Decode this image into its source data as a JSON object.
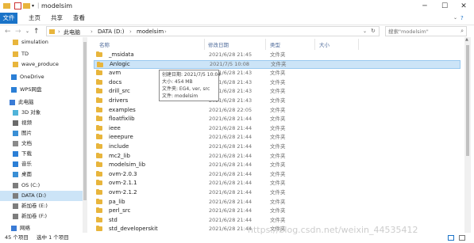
{
  "window": {
    "title": "modelsim"
  },
  "ribbon": {
    "tabs": [
      "文件",
      "主页",
      "共享",
      "查看"
    ]
  },
  "address": {
    "crumbs": [
      "此电脑",
      "DATA (D:)",
      "modelsim"
    ]
  },
  "search": {
    "placeholder": "搜索\"modelsim\""
  },
  "sidebar": {
    "items": [
      {
        "label": "simulation",
        "icon": "folder-icon"
      },
      {
        "label": "TD",
        "icon": "folder-icon"
      },
      {
        "label": "wave_produce",
        "icon": "folder-icon"
      },
      {
        "label": "OneDrive",
        "icon": "cloud-icon"
      },
      {
        "label": "WPS网盘",
        "icon": "cloud-icon"
      },
      {
        "label": "此电脑",
        "icon": "computer-icon"
      },
      {
        "label": "3D 对象",
        "icon": "cube-icon"
      },
      {
        "label": "视频",
        "icon": "video-icon"
      },
      {
        "label": "图片",
        "icon": "picture-icon"
      },
      {
        "label": "文档",
        "icon": "document-icon"
      },
      {
        "label": "下载",
        "icon": "download-icon"
      },
      {
        "label": "音乐",
        "icon": "music-icon"
      },
      {
        "label": "桌面",
        "icon": "desktop-icon"
      },
      {
        "label": "OS (C:)",
        "icon": "drive-icon"
      },
      {
        "label": "DATA (D:)",
        "icon": "drive-icon"
      },
      {
        "label": "新加卷 (E:)",
        "icon": "drive-icon"
      },
      {
        "label": "新加卷 (F:)",
        "icon": "drive-icon"
      },
      {
        "label": "网络",
        "icon": "network-icon"
      }
    ]
  },
  "columns": {
    "name": "名称",
    "date": "修改日期",
    "type": "类型",
    "size": "大小"
  },
  "files": [
    {
      "name": "_msidata",
      "date": "2021/6/28 21:45",
      "type": "文件夹"
    },
    {
      "name": "Anlogic",
      "date": "2021/7/5 10:08",
      "type": "文件夹"
    },
    {
      "name": "avm",
      "date": "2021/6/28 21:43",
      "type": "文件夹"
    },
    {
      "name": "docs",
      "date": "2021/6/28 21:43",
      "type": "文件夹"
    },
    {
      "name": "drill_src",
      "date": "2021/6/28 21:43",
      "type": "文件夹"
    },
    {
      "name": "drivers",
      "date": "2021/6/28 21:43",
      "type": "文件夹"
    },
    {
      "name": "examples",
      "date": "2021/6/28 22:05",
      "type": "文件夹"
    },
    {
      "name": "floatfixlib",
      "date": "2021/6/28 21:44",
      "type": "文件夹"
    },
    {
      "name": "ieee",
      "date": "2021/6/28 21:44",
      "type": "文件夹"
    },
    {
      "name": "ieeepure",
      "date": "2021/6/28 21:44",
      "type": "文件夹"
    },
    {
      "name": "include",
      "date": "2021/6/28 21:44",
      "type": "文件夹"
    },
    {
      "name": "mc2_lib",
      "date": "2021/6/28 21:44",
      "type": "文件夹"
    },
    {
      "name": "modelsim_lib",
      "date": "2021/6/28 21:44",
      "type": "文件夹"
    },
    {
      "name": "ovm-2.0.3",
      "date": "2021/6/28 21:44",
      "type": "文件夹"
    },
    {
      "name": "ovm-2.1.1",
      "date": "2021/6/28 21:44",
      "type": "文件夹"
    },
    {
      "name": "ovm-2.1.2",
      "date": "2021/6/28 21:44",
      "type": "文件夹"
    },
    {
      "name": "pa_lib",
      "date": "2021/6/28 21:44",
      "type": "文件夹"
    },
    {
      "name": "perl_src",
      "date": "2021/6/28 21:44",
      "type": "文件夹"
    },
    {
      "name": "std",
      "date": "2021/6/28 21:44",
      "type": "文件夹"
    },
    {
      "name": "std_developerskit",
      "date": "2021/6/28 21:44",
      "type": "文件夹"
    }
  ],
  "tooltip": {
    "created": "创建日期: 2021/7/5 10:04",
    "size": "大小: 454 MB",
    "files": "文件夹: EG4, ver, src",
    "filelist": "文件: modelsim"
  },
  "status": {
    "count": "45 个项目",
    "selected": "选中 1 个项目"
  },
  "watermark": "https://blog.csdn.net/weixin_44535412"
}
